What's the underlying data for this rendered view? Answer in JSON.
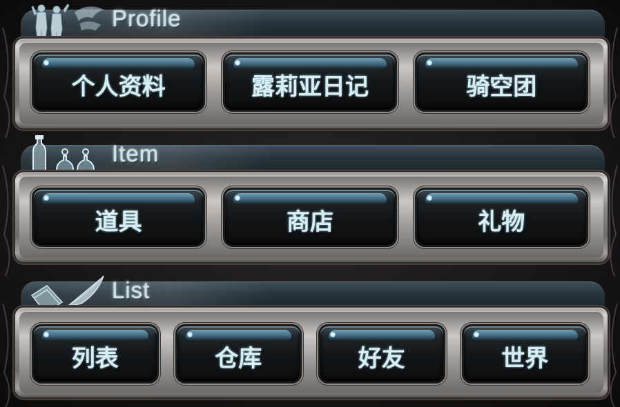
{
  "sections": [
    {
      "id": "profile",
      "title": "Profile",
      "icon": "knights-silhouette-icon",
      "buttons": [
        {
          "label": "个人资料"
        },
        {
          "label": "露莉亚日记"
        },
        {
          "label": "骑空团"
        }
      ]
    },
    {
      "id": "item",
      "title": "Item",
      "icon": "potion-bottles-icon",
      "buttons": [
        {
          "label": "道具"
        },
        {
          "label": "商店"
        },
        {
          "label": "礼物"
        }
      ]
    },
    {
      "id": "list",
      "title": "List",
      "icon": "book-quill-icon",
      "buttons": [
        {
          "label": "列表"
        },
        {
          "label": "仓库"
        },
        {
          "label": "好友"
        },
        {
          "label": "世界"
        }
      ]
    }
  ],
  "colors": {
    "label_text": "#d8eef4",
    "header_text": "#cfe2ea",
    "button_highlight": "#7fb1cc",
    "frame_metal": "#bfbcb9"
  }
}
